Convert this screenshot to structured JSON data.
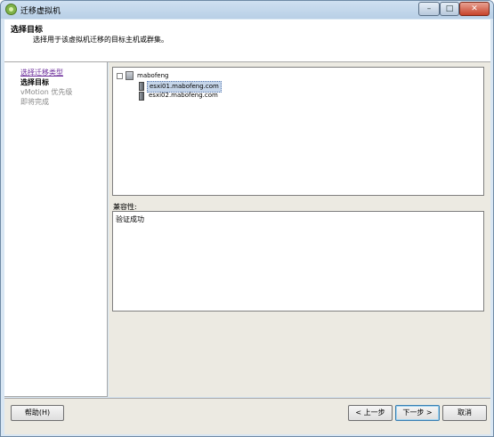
{
  "window": {
    "title": "迁移虚拟机",
    "controls": {
      "minimize": "–",
      "maximize": "□",
      "close": "✕"
    }
  },
  "header": {
    "title": "选择目标",
    "subtitle": "选择用于该虚拟机迁移的目标主机或群集。"
  },
  "nav": {
    "items": [
      {
        "label": "选择迁移类型",
        "state": "link"
      },
      {
        "label": "选择目标",
        "state": "current"
      },
      {
        "label": "vMotion 优先级",
        "state": "future"
      },
      {
        "label": "即将完成",
        "state": "future"
      }
    ]
  },
  "tree": {
    "expander": "⊟",
    "cluster": "mabofeng",
    "hosts": [
      {
        "label": "esxi01.mabofeng.com",
        "selected": true
      },
      {
        "label": "esxi02.mabofeng.com",
        "selected": false
      }
    ]
  },
  "compatibility": {
    "label": "兼容性:",
    "result": "验证成功"
  },
  "buttons": {
    "help": "帮助(H)",
    "back": "< 上一步",
    "next": "下一步 >",
    "cancel": "取消"
  }
}
